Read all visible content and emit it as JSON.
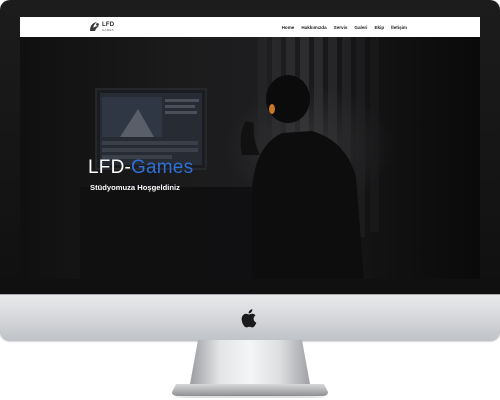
{
  "site": {
    "logo": {
      "text": "LFD",
      "subtext": "GAMES"
    },
    "nav": {
      "items": [
        {
          "label": "Home"
        },
        {
          "label": "Hakkımızda"
        },
        {
          "label": "Servis"
        },
        {
          "label": "Galeri"
        },
        {
          "label": "Ekip"
        },
        {
          "label": "İletişim"
        }
      ]
    },
    "hero": {
      "title_part1": "LFD-",
      "title_part2": "Games",
      "subtitle": "Stüdyomuza Hoşgeldiniz"
    }
  },
  "device": {
    "brand_icon": "apple-icon"
  },
  "colors": {
    "accent": "#2f6fd6",
    "nav_background": "#ffffff",
    "hero_background": "#141415"
  }
}
